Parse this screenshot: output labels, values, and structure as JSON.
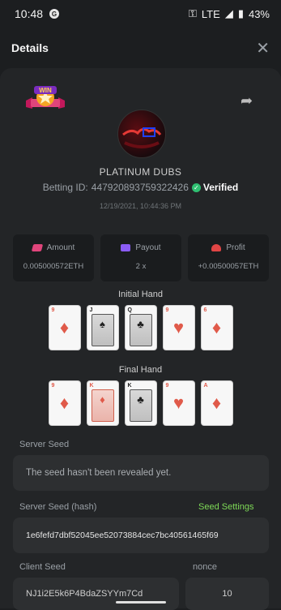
{
  "status_bar": {
    "time": "10:48",
    "network": "LTE",
    "battery": "43%"
  },
  "header": {
    "title": "Details",
    "close_icon": "close-icon"
  },
  "badge": {
    "text": "WIN"
  },
  "user": {
    "name": "PLATINUM DUBS",
    "betting_id_label": "Betting ID:",
    "betting_id": "447920893759322426",
    "verified": "Verified",
    "timestamp": "12/19/2021, 10:44:36 PM"
  },
  "stats": [
    {
      "label": "Amount",
      "value": "0.005000572ETH",
      "icon": "amount-icon"
    },
    {
      "label": "Payout",
      "value": "2 x",
      "icon": "payout-icon"
    },
    {
      "label": "Profit",
      "value": "+0.00500057ETH",
      "icon": "profit-icon"
    }
  ],
  "initial_hand": {
    "title": "Initial Hand",
    "cards": [
      {
        "rank": "9",
        "suit": "♦",
        "color": "red",
        "face": false
      },
      {
        "rank": "J",
        "suit": "♠",
        "color": "black",
        "face": true
      },
      {
        "rank": "Q",
        "suit": "♣",
        "color": "black",
        "face": true
      },
      {
        "rank": "9",
        "suit": "♥",
        "color": "red",
        "face": false
      },
      {
        "rank": "6",
        "suit": "♦",
        "color": "red",
        "face": false
      }
    ]
  },
  "final_hand": {
    "title": "Final Hand",
    "cards": [
      {
        "rank": "9",
        "suit": "♦",
        "color": "red",
        "face": false
      },
      {
        "rank": "K",
        "suit": "♦",
        "color": "red",
        "face": true
      },
      {
        "rank": "K",
        "suit": "♣",
        "color": "black",
        "face": true
      },
      {
        "rank": "9",
        "suit": "♥",
        "color": "red",
        "face": false
      },
      {
        "rank": "A",
        "suit": "♦",
        "color": "red",
        "face": false
      }
    ]
  },
  "seeds": {
    "server_seed_label": "Server Seed",
    "server_seed_value": "The seed hasn't been revealed yet.",
    "server_hash_label": "Server Seed (hash)",
    "seed_settings": "Seed Settings",
    "server_hash_value": "1e6fefd7dbf52045ee52073884cec7bc40561465f69",
    "client_seed_label": "Client Seed",
    "client_seed_value": "NJ1i2E5k6P4BdaZSYYm7Cd",
    "nonce_label": "nonce",
    "nonce_value": "10"
  },
  "colors": {
    "accent_green": "#7ed957",
    "verified_green": "#2fbf71",
    "background": "#1c1e20"
  }
}
